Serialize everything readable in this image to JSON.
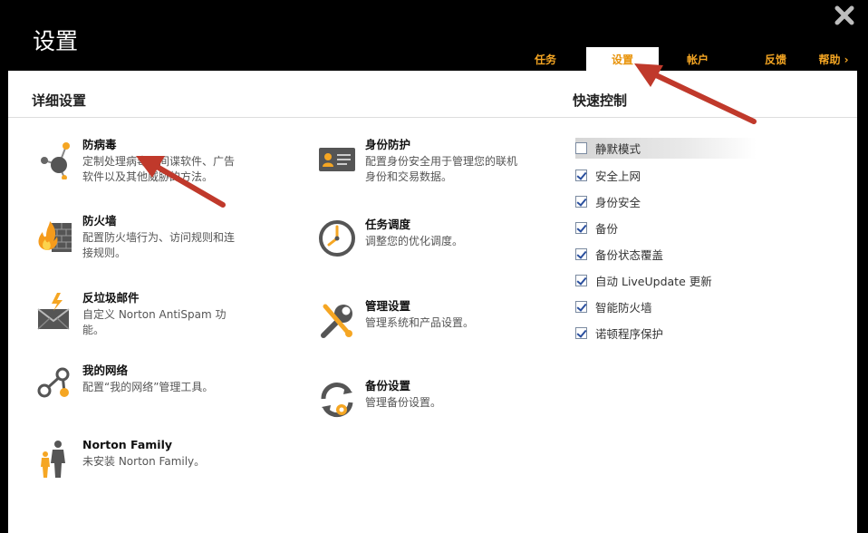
{
  "window": {
    "title": "设置"
  },
  "tabs": [
    {
      "label": "任务",
      "active": false
    },
    {
      "label": "设置",
      "active": true
    },
    {
      "label": "帐户",
      "active": false
    },
    {
      "label": "反馈",
      "active": false
    },
    {
      "label": "帮助 ›",
      "active": false
    }
  ],
  "detail": {
    "title": "详细设置",
    "items": [
      {
        "title": "防病毒",
        "desc1": "定制处理病毒、间谍软件、广告",
        "desc2": "软件以及其他威胁的方法。",
        "icon": "network-icon"
      },
      {
        "title": "防火墙",
        "desc1": "配置防火墙行为、访问规则和连",
        "desc2": "接规则。",
        "icon": "firewall-icon"
      },
      {
        "title": "反垃圾邮件",
        "desc1": "自定义 Norton AntiSpam 功",
        "desc2": "能。",
        "icon": "mail-icon"
      },
      {
        "title": "我的网络",
        "desc1": "配置“我的网络”管理工具。",
        "desc2": "",
        "icon": "mynetwork-icon"
      },
      {
        "title": "Norton Family",
        "desc1": "未安装 Norton Family。",
        "desc2": "",
        "icon": "family-icon"
      },
      {
        "title": "身份防护",
        "desc1": "配置身份安全用于管理您的联机",
        "desc2": "身份和交易数据。",
        "icon": "id-card-icon"
      },
      {
        "title": "任务调度",
        "desc1": "调整您的优化调度。",
        "desc2": "",
        "icon": "clock-icon"
      },
      {
        "title": "管理设置",
        "desc1": "管理系统和产品设置。",
        "desc2": "",
        "icon": "wrench-icon"
      },
      {
        "title": "备份设置",
        "desc1": "管理备份设置。",
        "desc2": "",
        "icon": "backup-icon"
      }
    ]
  },
  "quick": {
    "title": "快速控制",
    "items": [
      {
        "label": "静默模式",
        "checked": false
      },
      {
        "label": "安全上网",
        "checked": true
      },
      {
        "label": "身份安全",
        "checked": true
      },
      {
        "label": "备份",
        "checked": true
      },
      {
        "label": "备份状态覆盖",
        "checked": true
      },
      {
        "label": "自动 LiveUpdate 更新",
        "checked": true
      },
      {
        "label": "智能防火墙",
        "checked": true
      },
      {
        "label": "诺顿程序保护",
        "checked": true
      }
    ]
  },
  "colors": {
    "accent": "#f5a623",
    "arrow": "#c0392b",
    "header_bg": "#000000"
  }
}
